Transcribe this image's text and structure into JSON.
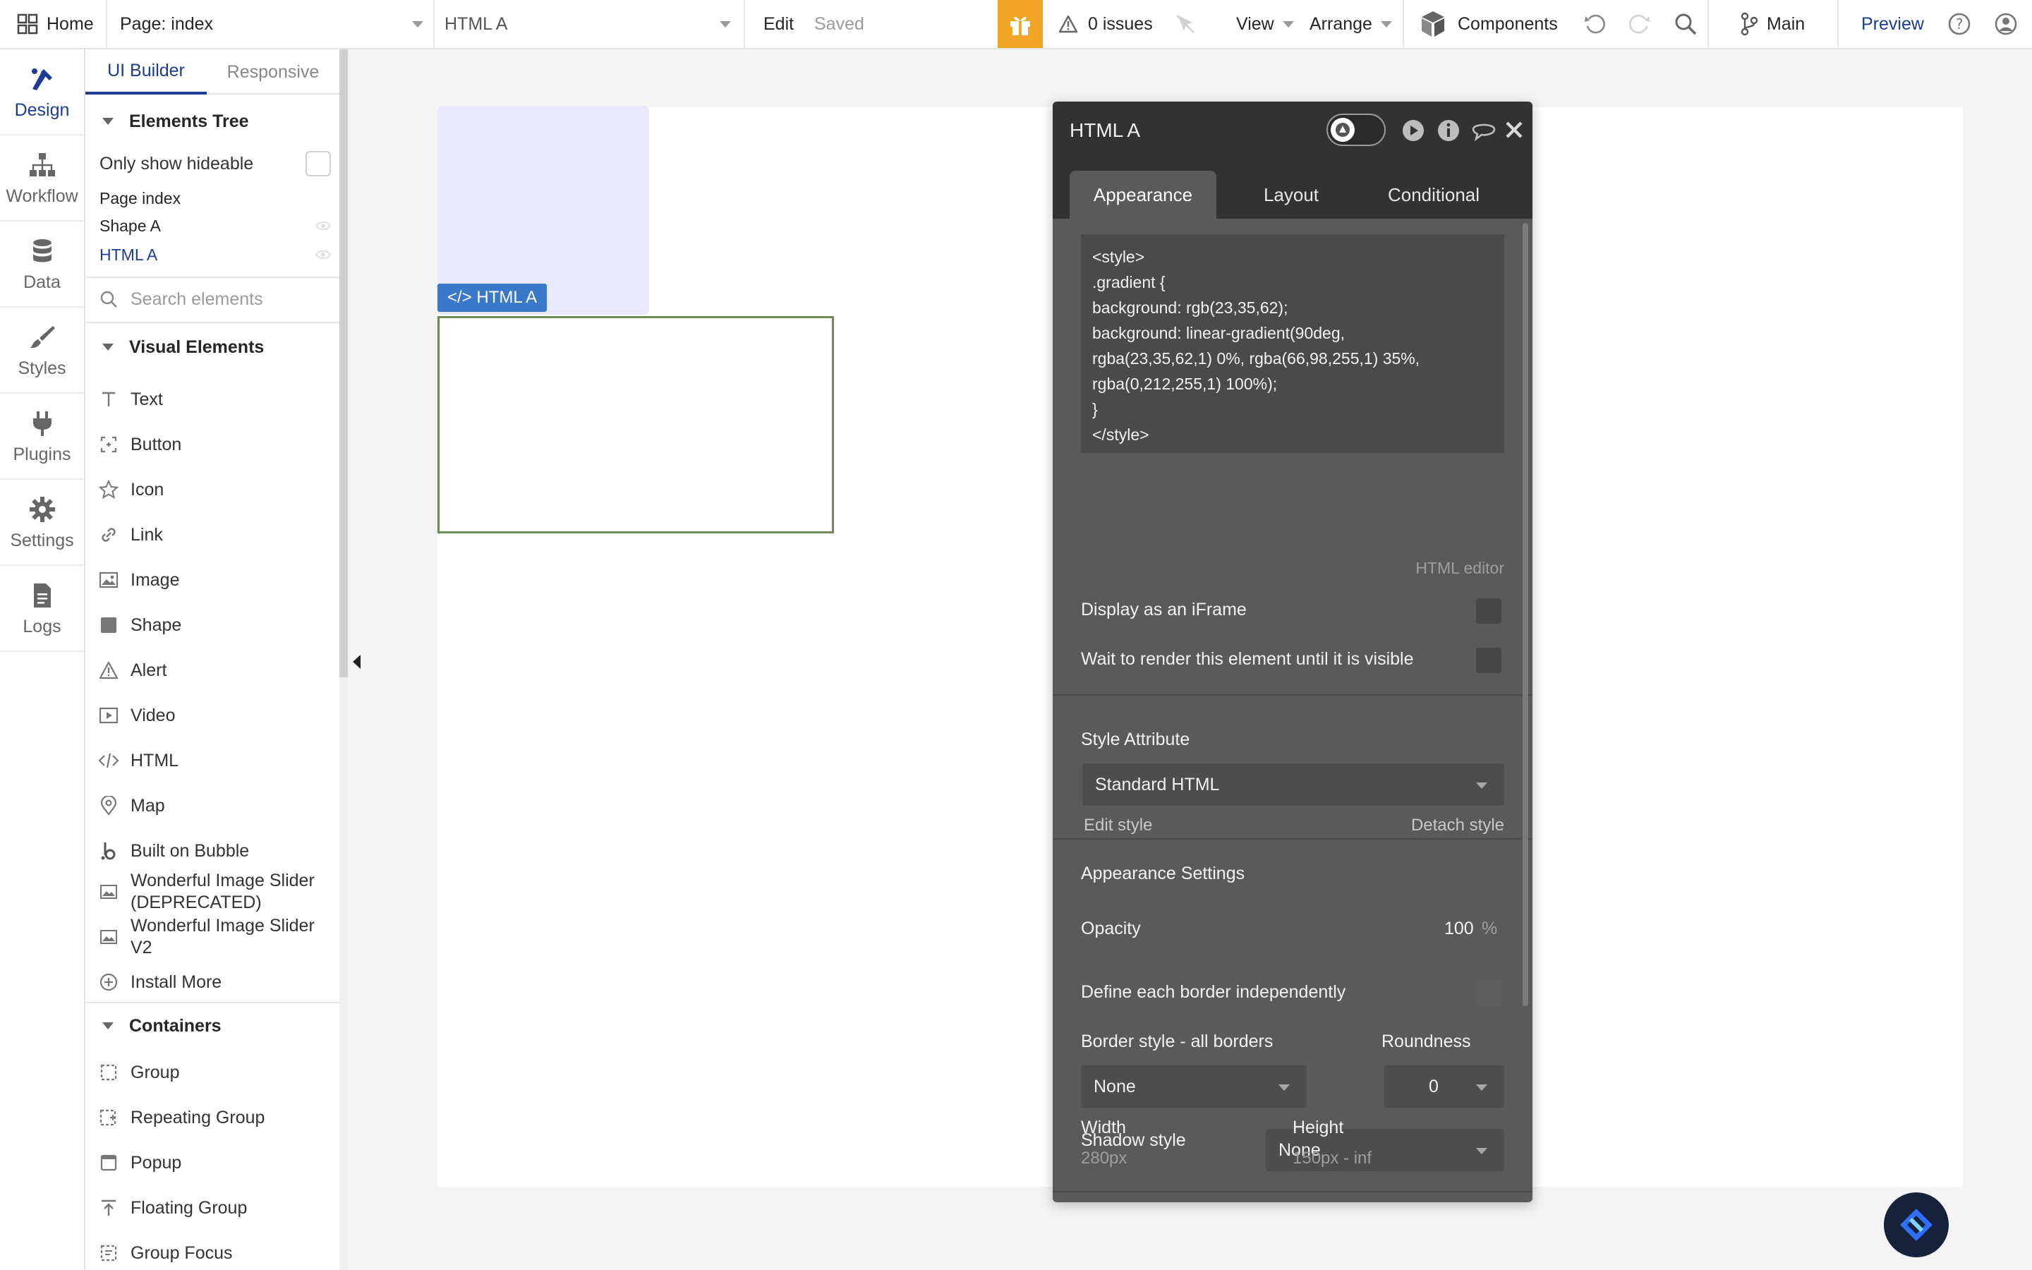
{
  "topbar": {
    "home_label": "Home",
    "page_selector": "Page: index",
    "element_selector": "HTML A",
    "edit_label": "Edit",
    "saved_label": "Saved",
    "issues_label": "0 issues",
    "view_label": "View",
    "arrange_label": "Arrange",
    "components_label": "Components",
    "branch_label": "Main",
    "preview_label": "Preview"
  },
  "rail": {
    "items": [
      {
        "label": "Design",
        "icon": "design-icon"
      },
      {
        "label": "Workflow",
        "icon": "workflow-icon"
      },
      {
        "label": "Data",
        "icon": "database-icon"
      },
      {
        "label": "Styles",
        "icon": "brush-icon"
      },
      {
        "label": "Plugins",
        "icon": "plug-icon"
      },
      {
        "label": "Settings",
        "icon": "gear-icon"
      },
      {
        "label": "Logs",
        "icon": "document-icon"
      }
    ]
  },
  "panel": {
    "tabs": [
      "UI Builder",
      "Responsive"
    ],
    "elements_tree": {
      "title": "Elements Tree",
      "only_hideable": "Only show hideable",
      "items": [
        "Page index",
        "Shape A",
        "HTML A"
      ]
    },
    "search_placeholder": "Search elements",
    "visual_elements": {
      "title": "Visual Elements",
      "items": [
        "Text",
        "Button",
        "Icon",
        "Link",
        "Image",
        "Shape",
        "Alert",
        "Video",
        "HTML",
        "Map",
        "Built on Bubble",
        "Wonderful Image Slider (DEPRECATED)",
        "Wonderful Image Slider V2",
        "Install More"
      ]
    },
    "containers": {
      "title": "Containers",
      "items": [
        "Group",
        "Repeating Group",
        "Popup",
        "Floating Group",
        "Group Focus"
      ]
    }
  },
  "canvas": {
    "html_tag_label": "</> HTML A"
  },
  "editor": {
    "title": "HTML A",
    "tabs": [
      "Appearance",
      "Layout",
      "Conditional"
    ],
    "code_lines": [
      "<style>",
      ".gradient {",
      "background: rgb(23,35,62);",
      "background: linear-gradient(90deg,",
      "rgba(23,35,62,1) 0%, rgba(66,98,255,1) 35%,",
      "rgba(0,212,255,1) 100%);",
      "}",
      "</style>"
    ],
    "html_editor_label": "HTML editor",
    "display_iframe": "Display as an iFrame",
    "wait_render": "Wait to render this element until it is visible",
    "style_attribute": "Style Attribute",
    "style_value": "Standard HTML",
    "edit_style": "Edit style",
    "detach_style": "Detach style",
    "appearance_settings": "Appearance Settings",
    "opacity_label": "Opacity",
    "opacity_value": "100",
    "opacity_unit": "%",
    "define_border": "Define each border independently",
    "border_style_label": "Border style - all borders",
    "roundness_label": "Roundness",
    "border_style_value": "None",
    "roundness_value": "0",
    "shadow_label": "Shadow style",
    "shadow_value": "None",
    "width_label": "Width",
    "width_value": "280px",
    "height_label": "Height",
    "height_value": "150px - inf"
  },
  "colors": {
    "accent": "#1c3d91",
    "gift": "#f2a626",
    "editor_bg": "#5a5a5a",
    "editor_header": "#323232",
    "selection_border": "#6f8b52",
    "tag_blue": "#3a78c9"
  }
}
